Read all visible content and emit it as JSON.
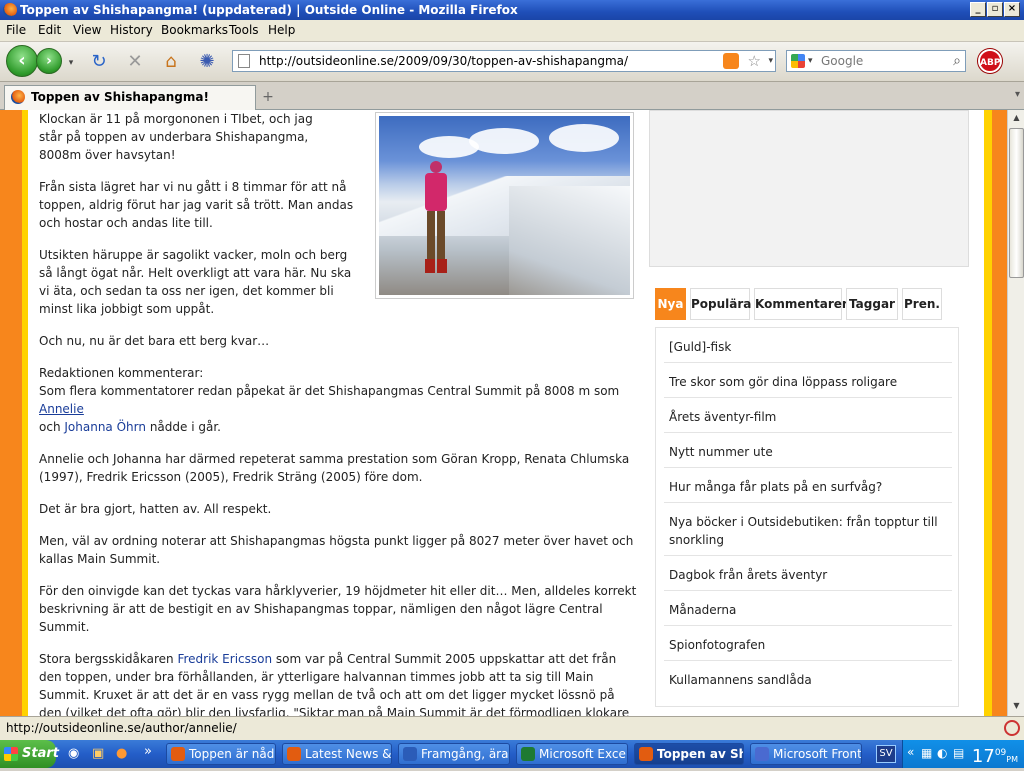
{
  "window": {
    "title": "Toppen av Shishapangma! (uppdaterad) | Outside Online - Mozilla Firefox"
  },
  "menu": [
    "File",
    "Edit",
    "View",
    "History",
    "Bookmarks",
    "Tools",
    "Help"
  ],
  "nav": {
    "url": "http://outsideonline.se/2009/09/30/toppen-av-shishapangma/",
    "search_placeholder": "Google",
    "abp": "ABP"
  },
  "tab": {
    "label": "Toppen av Shishapangma! (uppdate...",
    "new_tab": "+"
  },
  "article": {
    "p1": "Klockan är 11 på morgononen i TIbet, och jag står på toppen av underbara Shishapangma, 8008m över havsytan!",
    "p2": "Från sista lägret har vi nu gått i 8 timmar för att nå toppen, aldrig förut har jag varit så trött. Man andas och hostar och andas lite till.",
    "p3": "Utsikten häruppe är sagolikt vacker, moln och berg så långt ögat når. Helt overkligt att vara här. Nu ska vi äta, och sedan ta oss ner igen, det kommer bli minst lika jobbigt som uppåt.",
    "p4": "Och nu, nu är det bara ett berg kvar…",
    "p5_head": "Redaktionen kommenterar:",
    "p5_text": "Som flera kommentatorer redan påpekat är det Shishapangmas Central Summit på 8008 m som",
    "p5_link1": "Annelie",
    "p5_and": "och",
    "p5_link2": "Johanna Öhrn",
    "p5_end": "nådde i går.",
    "p6": "Annelie och Johanna har därmed repeterat samma prestation som Göran Kropp, Renata Chlumska (1997), Fredrik Ericsson (2005), Fredrik Sträng (2005) före dom.",
    "p7": "Det är bra gjort, hatten av. All respekt.",
    "p8": "Men, väl av ordning noterar att Shishapangmas högsta punkt ligger på 8027 meter över havet och kallas Main Summit.",
    "p9": "För den oinvigde kan det tyckas vara hårklyverier, 19 höjdmeter hit eller dit… Men, alldeles korrekt beskrivning är att de bestigit en av Shishapangmas toppar, nämligen den något lägre Central Summit.",
    "p10_a": "Stora bergsskidåkaren",
    "p10_link": "Fredrik Ericsson",
    "p10_b": "som var på Central Summit 2005 uppskattar att det från den toppen, under bra förhållanden, är ytterligare halvannan timmes jobb att ta sig till Main Summit. Kruxet är att det är en vass rygg mellan de två och att om det ligger mycket lössnö på den (vilket det ofta gör) blir den livsfarlig. \"Siktar man på Main Summit är det förmodligen klokare att strunta i Central Summit och istället traversera direkt upp till Main Summit, det förekommer men är inte så vanligt.\", säger Fredrik."
  },
  "sidebar": {
    "tabs": [
      "Nya",
      "Populära",
      "Kommentarer",
      "Taggar",
      "Pren."
    ],
    "items": [
      "[Guld]-fisk",
      "Tre skor som gör dina löppass roligare",
      "Årets äventyr-film",
      "Nytt nummer ute",
      "Hur många får plats på en surfvåg?",
      "Nya böcker i Outsidebutiken: från topptur till snorkling",
      "Dagbok från årets äventyr",
      "Månaderna",
      "Spionfotografen",
      "Kullamannens sandlåda"
    ]
  },
  "status": {
    "text": "http://outsideonline.se/author/annelie/"
  },
  "taskbar": {
    "start": "Start",
    "tasks": [
      "Toppen är nåd...",
      "Latest News & ...",
      "Framgång, ära...",
      "Microsoft Excel...",
      "Toppen av Sh...",
      "Microsoft Front..."
    ],
    "tray_lang": "SV",
    "clock": "17",
    "clock_min": "09",
    "clock_pm": "PM"
  },
  "colors": {
    "orange": "#f7861c",
    "yellow": "#ffd200",
    "active_tab": "#f7861c",
    "link": "#1a3d99"
  }
}
